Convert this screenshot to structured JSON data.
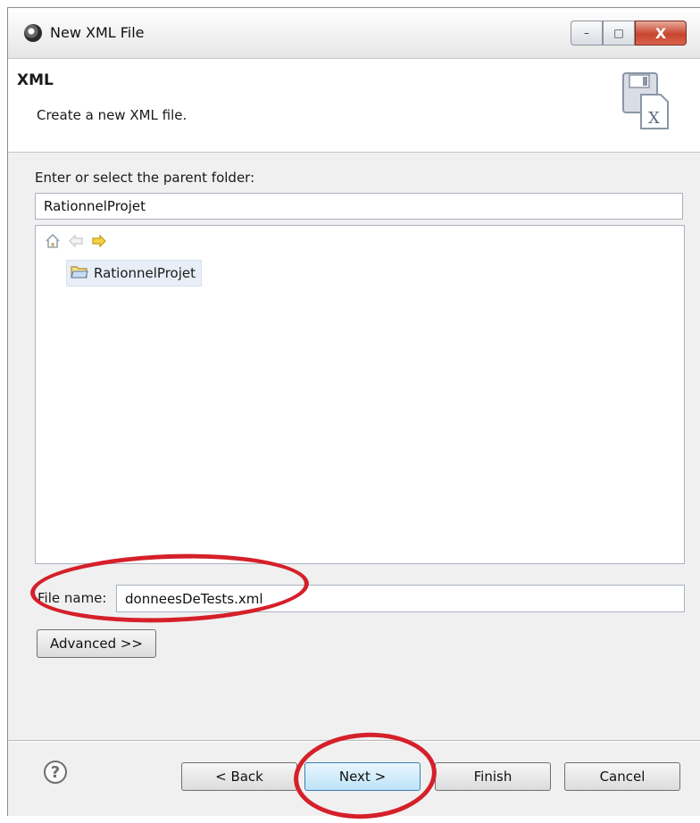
{
  "window": {
    "title": "New XML File",
    "caption_buttons": {
      "minimize": "–",
      "maximize": "□",
      "close": "X"
    }
  },
  "banner": {
    "title": "XML",
    "description": "Create a new XML file.",
    "icon": "xml-file-wizard-icon",
    "icon_letter": "X"
  },
  "parent_folder": {
    "label": "Enter or select the parent folder:",
    "value": "RationnelProjet"
  },
  "tree": {
    "toolbar_icons": [
      "home-icon",
      "back-arrow-icon",
      "forward-arrow-icon"
    ],
    "items": [
      {
        "label": "RationnelProjet",
        "icon": "open-project-folder-icon"
      }
    ]
  },
  "file_name": {
    "label": "File name:",
    "value": "donneesDeTests.xml"
  },
  "advanced_button": "Advanced >>",
  "footer": {
    "help": "?",
    "back": "< Back",
    "next": "Next >",
    "finish": "Finish",
    "cancel": "Cancel"
  },
  "annotation_color": "#d5202a"
}
